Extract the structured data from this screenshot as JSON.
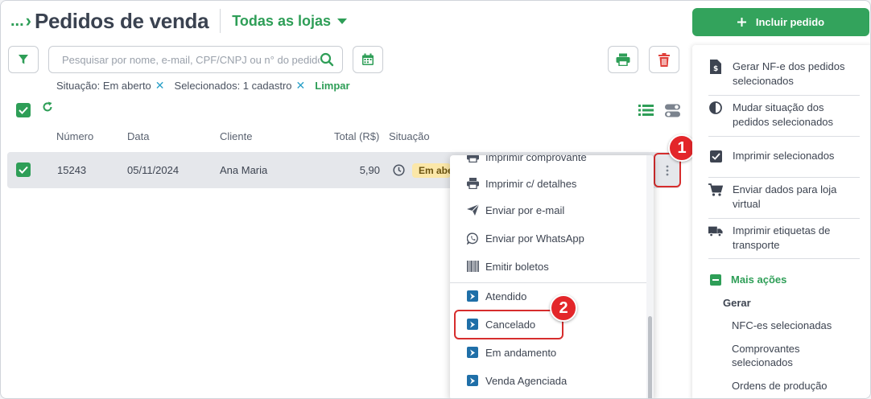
{
  "header": {
    "breadcrumb": "...",
    "title": "Pedidos de venda",
    "store_selector": "Todas as lojas"
  },
  "toolbar": {
    "search_placeholder": "Pesquisar por nome, e-mail, CPF/CNPJ ou n° do pedido"
  },
  "filters": {
    "chips": [
      "Situação: Em aberto",
      "Selecionados: 1 cadastro"
    ],
    "clear_label": "Limpar"
  },
  "table": {
    "columns": [
      "Número",
      "Data",
      "Cliente",
      "Total (R$)",
      "Situação"
    ],
    "rows": [
      {
        "numero": "15243",
        "data": "05/11/2024",
        "cliente": "Ana Maria",
        "total": "5,90",
        "situacao": "Em aberto"
      }
    ]
  },
  "markers": [
    "1",
    "2"
  ],
  "row_menu": {
    "actions": [
      {
        "label": "Imprimir comprovante",
        "icon": "printer-icon"
      },
      {
        "label": "Imprimir c/ detalhes",
        "icon": "printer-icon"
      },
      {
        "label": "Enviar por e-mail",
        "icon": "send-icon"
      },
      {
        "label": "Enviar por WhatsApp",
        "icon": "whatsapp-icon"
      },
      {
        "label": "Emitir boletos",
        "icon": "barcode-icon"
      }
    ],
    "statuses": [
      {
        "label": "Atendido",
        "icon": "status-arrow-icon"
      },
      {
        "label": "Cancelado",
        "icon": "status-arrow-icon"
      },
      {
        "label": "Em andamento",
        "icon": "status-arrow-icon"
      },
      {
        "label": "Venda Agenciada",
        "icon": "status-arrow-icon"
      }
    ]
  },
  "side_panel": {
    "primary_button": "Incluir pedido",
    "items": [
      {
        "label": "Gerar NF-e dos pedidos selecionados",
        "icon": "invoice-icon"
      },
      {
        "label": "Mudar situação dos pedidos selecionados",
        "icon": "half-circle-icon"
      },
      {
        "label": "Imprimir selecionados",
        "icon": "checkbox-icon"
      },
      {
        "label": "Enviar dados para loja virtual",
        "icon": "cart-icon"
      },
      {
        "label": "Imprimir etiquetas de transporte",
        "icon": "truck-icon"
      }
    ],
    "more_actions": "Mais ações",
    "gerar_label": "Gerar",
    "gerar_items": [
      "NFC-es selecionadas",
      "Comprovantes selecionados",
      "Ordens de produção"
    ]
  },
  "colors": {
    "accent_green": "#2e9e57",
    "danger_red": "#e0403a",
    "marker_red": "#e3262a",
    "status_blue": "#1f6fa8",
    "badge_yellow": "#fbe7a9"
  }
}
